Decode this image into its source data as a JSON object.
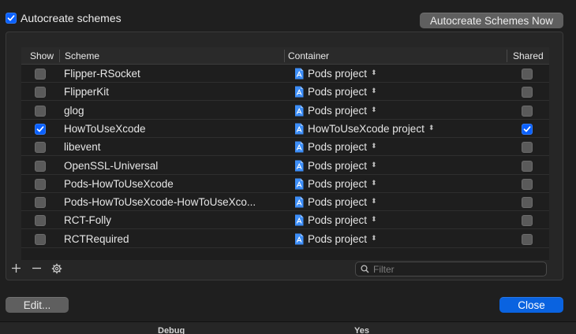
{
  "top": {
    "autocreate_label": "Autocreate schemes",
    "autocreate_checked": true,
    "autocreate_now_label": "Autocreate Schemes Now"
  },
  "table": {
    "headers": {
      "show": "Show",
      "scheme": "Scheme",
      "container": "Container",
      "shared": "Shared"
    },
    "rows": [
      {
        "show": false,
        "scheme": "Flipper-RSocket",
        "container": "Pods project",
        "shared": false
      },
      {
        "show": false,
        "scheme": "FlipperKit",
        "container": "Pods project",
        "shared": false
      },
      {
        "show": false,
        "scheme": "glog",
        "container": "Pods project",
        "shared": false
      },
      {
        "show": true,
        "scheme": "HowToUseXcode",
        "container": "HowToUseXcode project",
        "shared": true
      },
      {
        "show": false,
        "scheme": "libevent",
        "container": "Pods project",
        "shared": false
      },
      {
        "show": false,
        "scheme": "OpenSSL-Universal",
        "container": "Pods project",
        "shared": false
      },
      {
        "show": false,
        "scheme": "Pods-HowToUseXcode",
        "container": "Pods project",
        "shared": false
      },
      {
        "show": false,
        "scheme": "Pods-HowToUseXcode-HowToUseXco...",
        "container": "Pods project",
        "shared": false
      },
      {
        "show": false,
        "scheme": "RCT-Folly",
        "container": "Pods project",
        "shared": false
      },
      {
        "show": false,
        "scheme": "RCTRequired",
        "container": "Pods project",
        "shared": false
      }
    ]
  },
  "toolbar": {
    "add_icon": "plus-icon",
    "remove_icon": "minus-icon",
    "settings_icon": "gear-icon",
    "filter_placeholder": "Filter"
  },
  "footer": {
    "edit_label": "Edit...",
    "close_label": "Close"
  },
  "behind": {
    "debug_label": "Debug",
    "yes_label": "Yes"
  },
  "colors": {
    "accent": "#0a63e0",
    "checkbox_on": "#0a60ff"
  }
}
